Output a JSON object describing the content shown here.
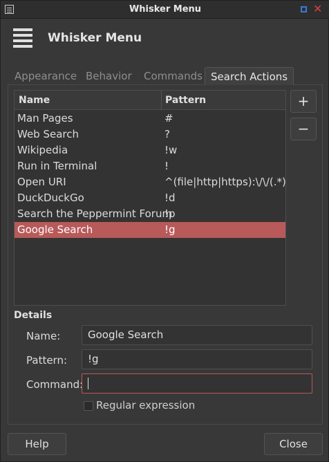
{
  "window": {
    "title": "Whisker Menu"
  },
  "header": {
    "title": "Whisker Menu",
    "icon": "hamburger-menu-icon"
  },
  "tabs": [
    {
      "label": "Appearance",
      "active": false
    },
    {
      "label": "Behavior",
      "active": false
    },
    {
      "label": "Commands",
      "active": false
    },
    {
      "label": "Search Actions",
      "active": true
    }
  ],
  "table": {
    "columns": [
      "Name",
      "Pattern"
    ],
    "rows": [
      {
        "name": "Man Pages",
        "pattern": "#"
      },
      {
        "name": "Web Search",
        "pattern": "?"
      },
      {
        "name": "Wikipedia",
        "pattern": "!w"
      },
      {
        "name": "Run in Terminal",
        "pattern": "!"
      },
      {
        "name": "Open URI",
        "pattern": "^(file|http|https):\\/\\/(.*)$"
      },
      {
        "name": "DuckDuckGo",
        "pattern": "!d"
      },
      {
        "name": "Search the Peppermint Forum",
        "pattern": "!p"
      },
      {
        "name": "Google Search",
        "pattern": "!g",
        "selected": true
      }
    ]
  },
  "side_buttons": {
    "add": "+",
    "remove": "−"
  },
  "details": {
    "title": "Details",
    "name_label": "Name:",
    "name_value": "Google Search",
    "pattern_label": "Pattern:",
    "pattern_value": "!g",
    "command_label": "Command:",
    "command_value": "",
    "regex_label": "Regular expression",
    "regex_checked": false
  },
  "footer": {
    "help": "Help",
    "close": "Close"
  },
  "colors": {
    "selection": "#b85a5a",
    "accent_blue": "#3a7bd5",
    "close_red": "#d94040"
  }
}
